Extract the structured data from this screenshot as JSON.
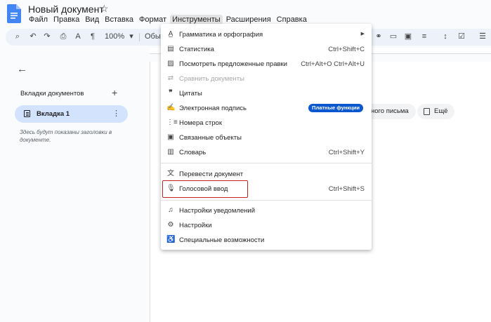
{
  "doc": {
    "title": "Новый документ"
  },
  "menubar": [
    "Файл",
    "Правка",
    "Вид",
    "Вставка",
    "Формат",
    "Инструменты",
    "Расширения",
    "Справка"
  ],
  "toolbar": {
    "zoom": "100%",
    "style": "Обыч"
  },
  "sidebar": {
    "tabs_title": "Вкладки документов",
    "tab_label": "Вкладка 1",
    "hint": "Здесь будут показаны заголовки в документе."
  },
  "page": {
    "chip_left": "ного письма",
    "chip_more": "Ещё"
  },
  "tools_menu": {
    "items": [
      {
        "label": "Грамматика и орфография",
        "icon": "spellcheck-icon",
        "submenu": true
      },
      {
        "label": "Статистика",
        "icon": "statistics-icon",
        "shortcut": "Ctrl+Shift+C"
      },
      {
        "label": "Посмотреть предложенные правки",
        "icon": "review-edits-icon",
        "shortcut": "Ctrl+Alt+O Ctrl+Alt+U"
      },
      {
        "label": "Сравнить документы",
        "icon": "compare-icon",
        "disabled": true
      },
      {
        "label": "Цитаты",
        "icon": "quote-icon"
      },
      {
        "label": "Электронная подпись",
        "icon": "signature-icon",
        "badge": "Платные функции"
      },
      {
        "label": "Номера строк",
        "icon": "line-numbers-icon"
      },
      {
        "label": "Связанные объекты",
        "icon": "linked-objects-icon"
      },
      {
        "label": "Словарь",
        "icon": "dictionary-icon",
        "shortcut": "Ctrl+Shift+Y"
      },
      {
        "label": "Перевести документ",
        "icon": "translate-icon"
      },
      {
        "label": "Голосовой ввод",
        "icon": "microphone-icon",
        "shortcut": "Ctrl+Shift+S"
      },
      {
        "label": "Настройки уведомлений",
        "icon": "bell-icon"
      },
      {
        "label": "Настройки",
        "icon": "preferences-icon"
      },
      {
        "label": "Специальные возможности",
        "icon": "accessibility-icon"
      }
    ]
  }
}
